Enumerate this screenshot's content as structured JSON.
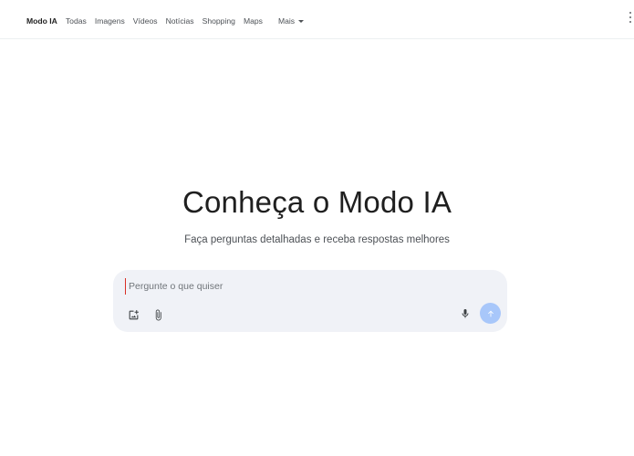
{
  "nav": {
    "tabs": [
      {
        "label": "Modo IA",
        "active": true
      },
      {
        "label": "Todas"
      },
      {
        "label": "Imagens"
      },
      {
        "label": "Vídeos"
      },
      {
        "label": "Notícias"
      },
      {
        "label": "Shopping"
      },
      {
        "label": "Maps"
      }
    ],
    "more_label": "Mais",
    "more_icon": "caret-down-icon",
    "menu_icon": "more-vert-icon"
  },
  "hero": {
    "title": "Conheça o Modo IA",
    "subtitle": "Faça perguntas detalhadas e receba respostas melhores"
  },
  "prompt": {
    "placeholder": "Pergunte o que quiser",
    "value": "",
    "tools": [
      "add-image-icon",
      "paperclip-icon",
      "microphone-icon",
      "send-arrow-icon"
    ],
    "send_button_color": "#a8c7fa"
  },
  "colors": {
    "text_primary": "#1f1f1f",
    "text_secondary": "#4d5156",
    "prompt_background": "#f0f2f7",
    "cursor": "#d93025"
  }
}
